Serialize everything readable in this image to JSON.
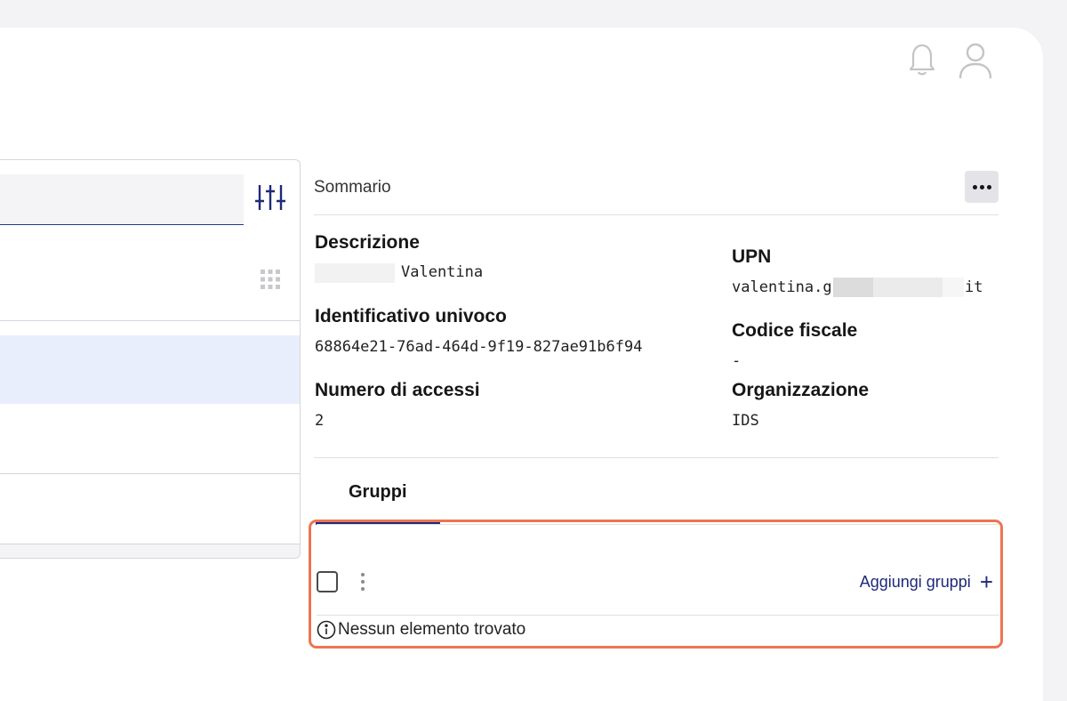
{
  "summary": {
    "title": "Sommario",
    "fields": {
      "descrizione": {
        "label": "Descrizione",
        "value": "Valentina"
      },
      "upn": {
        "label": "UPN",
        "value_prefix": "valentina.g",
        "value_suffix": "it"
      },
      "identificativo": {
        "label": "Identificativo univoco",
        "value": "68864e21-76ad-464d-9f19-827ae91b6f94"
      },
      "codice_fiscale": {
        "label": "Codice fiscale",
        "value": "-"
      },
      "numero_accessi": {
        "label": "Numero di accessi",
        "value": "2"
      },
      "organizzazione": {
        "label": "Organizzazione",
        "value": "IDS"
      }
    }
  },
  "tabs": {
    "gruppi": "Gruppi"
  },
  "groups": {
    "add_label": "Aggiungi gruppi",
    "add_symbol": "+",
    "empty_message": "Nessun elemento trovato"
  },
  "icons": {
    "bell": "bell-icon",
    "user": "user-icon",
    "filter": "sliders-icon",
    "grid": "grid-icon",
    "more": "overflow-menu-icon",
    "info": "info-icon"
  },
  "colors": {
    "accent": "#1f2a7a",
    "highlight_border": "#ed7550",
    "selected_row": "#e8eefc"
  }
}
